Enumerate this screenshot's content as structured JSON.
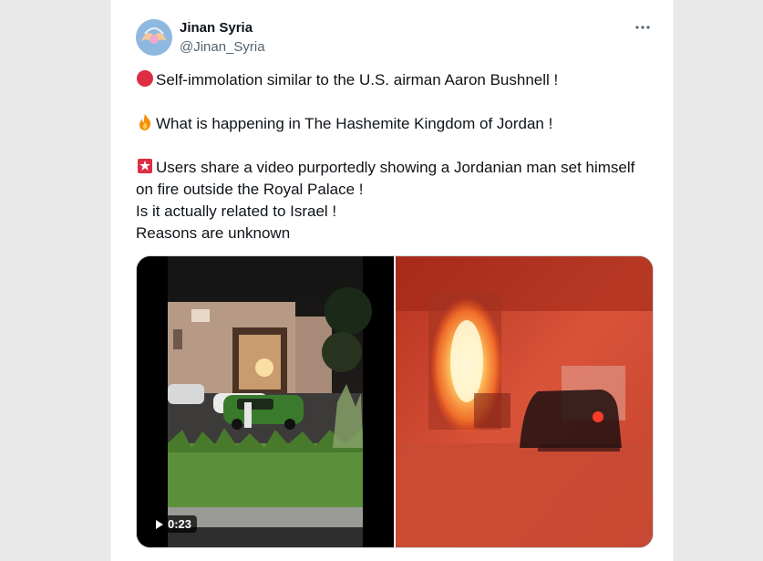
{
  "tweet": {
    "author_name": "Jinan Syria",
    "author_handle": "@Jinan_Syria",
    "more_icon": "more-horizontal-icon",
    "lines": [
      {
        "emoji": "red-circle",
        "text": "Self-immolation similar to the U.S. airman Aaron Bushnell !"
      },
      {
        "emoji": "fire",
        "text": "What is happening in The Hashemite Kingdom of Jordan !"
      },
      {
        "emoji": "siren",
        "text": "Users share a video purportedly showing a Jordanian man set himself"
      },
      {
        "text": "on fire outside the Royal Palace !"
      },
      {
        "text": "Is it actually related to Israel !"
      },
      {
        "text": "Reasons are unknown"
      }
    ],
    "video": {
      "duration": "0:23",
      "play_icon": "play-icon"
    }
  },
  "colors": {
    "text": "#0f1419",
    "secondary": "#536471",
    "background": "#ffffff"
  }
}
